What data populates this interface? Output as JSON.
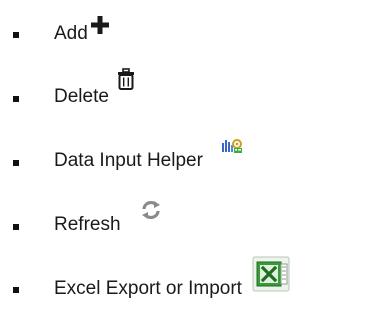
{
  "list": {
    "items": [
      {
        "label": "Add",
        "icon": "plus-icon"
      },
      {
        "label": "Delete",
        "icon": "trash-icon"
      },
      {
        "label": "Data Input Helper",
        "icon": "data-input-helper-icon"
      },
      {
        "label": "Refresh",
        "icon": "refresh-icon"
      },
      {
        "label": "Excel Export or Import",
        "icon": "excel-icon"
      }
    ]
  },
  "colors": {
    "text": "#1a1a1a",
    "bullet": "#111111",
    "icon_dark": "#1a1a1a",
    "icon_gray": "#8a8a8a",
    "excel_green": "#2e8b2e"
  }
}
